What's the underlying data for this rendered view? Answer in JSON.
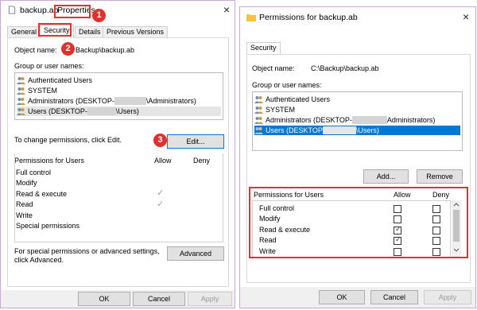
{
  "left_window": {
    "title_file": "backup.ab",
    "title_word": "Properties",
    "close": "×",
    "tabs": [
      "General",
      "Security",
      "Details",
      "Previous Versions"
    ],
    "object_name_label": "Object name:",
    "object_name_value": "Backup\\backup.ab",
    "group_label": "Group or user names:",
    "users": [
      {
        "label": "Authenticated Users"
      },
      {
        "label": "SYSTEM"
      },
      {
        "prefix": "Administrators (DESKTOP-",
        "suffix": "\\Administrators)"
      },
      {
        "prefix": "Users (DESKTOP-",
        "suffix": "\\Users)"
      }
    ],
    "change_text": "To change permissions, click Edit.",
    "edit_button": "Edit...",
    "permissions_header": "Permissions for Users",
    "allow_header": "Allow",
    "deny_header": "Deny",
    "permissions": [
      "Full control",
      "Modify",
      "Read & execute",
      "Read",
      "Write",
      "Special permissions"
    ],
    "allowed_marks": [
      "✓",
      "✓"
    ],
    "special_text_1": "For special permissions or advanced settings,",
    "special_text_2": "click Advanced.",
    "advanced_button": "Advanced",
    "ok_button": "OK",
    "cancel_button": "Cancel",
    "apply_button": "Apply"
  },
  "right_window": {
    "title": "Permissions for backup.ab",
    "close": "×",
    "tab": "Security",
    "object_name_label": "Object name:",
    "object_name_value": "C:\\Backup\\backup.ab",
    "group_label": "Group or user names:",
    "users": [
      {
        "label": "Authenticated Users"
      },
      {
        "label": "SYSTEM"
      },
      {
        "prefix": "Administrators (DESKTOP-",
        "suffix": "Administrators)"
      },
      {
        "prefix": "Users (DESKTOP",
        "suffix": "\\Users)"
      }
    ],
    "add_button": "Add...",
    "remove_button": "Remove",
    "permissions_header": "Permissions for Users",
    "allow_header": "Allow",
    "deny_header": "Deny",
    "permissions": [
      "Full control",
      "Modify",
      "Read & execute",
      "Read",
      "Write"
    ],
    "allow_checked": [
      false,
      false,
      true,
      true,
      false
    ],
    "deny_checked": [
      false,
      false,
      false,
      false,
      false
    ],
    "check_mark": "✓",
    "ok_button": "OK",
    "cancel_button": "Cancel",
    "apply_button": "Apply"
  },
  "callouts": [
    "1",
    "2",
    "3"
  ],
  "colors": {
    "highlight": "#e0312c",
    "selection": "#0078d7"
  }
}
